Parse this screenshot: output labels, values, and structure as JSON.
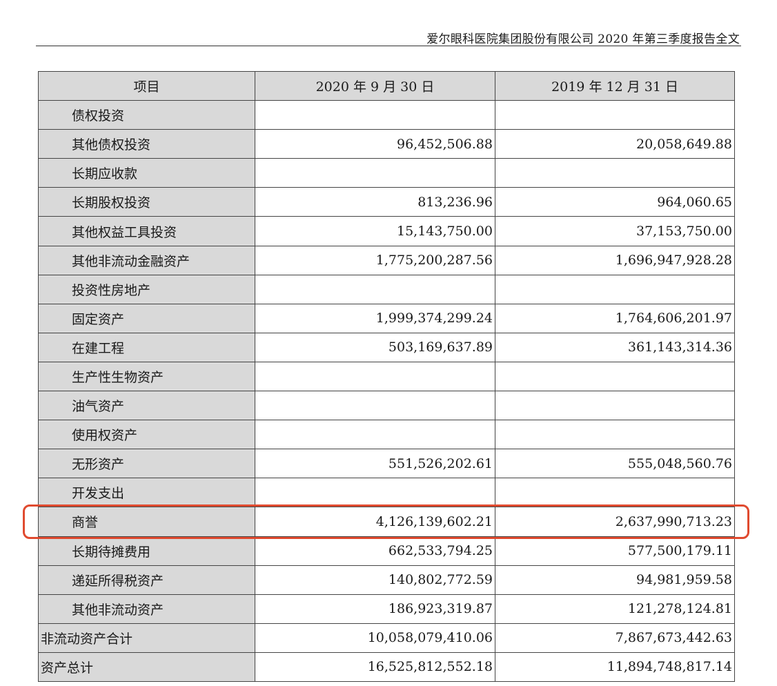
{
  "header": {
    "title": "爱尔眼科医院集团股份有限公司 2020 年第三季度报告全文"
  },
  "table": {
    "columns": [
      "项目",
      "2020 年 9 月 30 日",
      "2019 年 12 月 31 日"
    ],
    "rows": [
      {
        "item": "债权投资",
        "a": "",
        "b": ""
      },
      {
        "item": "其他债权投资",
        "a": "96,452,506.88",
        "b": "20,058,649.88"
      },
      {
        "item": "长期应收款",
        "a": "",
        "b": ""
      },
      {
        "item": "长期股权投资",
        "a": "813,236.96",
        "b": "964,060.65"
      },
      {
        "item": "其他权益工具投资",
        "a": "15,143,750.00",
        "b": "37,153,750.00"
      },
      {
        "item": "其他非流动金融资产",
        "a": "1,775,200,287.56",
        "b": "1,696,947,928.28"
      },
      {
        "item": "投资性房地产",
        "a": "",
        "b": ""
      },
      {
        "item": "固定资产",
        "a": "1,999,374,299.24",
        "b": "1,764,606,201.97"
      },
      {
        "item": "在建工程",
        "a": "503,169,637.89",
        "b": "361,143,314.36"
      },
      {
        "item": "生产性生物资产",
        "a": "",
        "b": ""
      },
      {
        "item": "油气资产",
        "a": "",
        "b": ""
      },
      {
        "item": "使用权资产",
        "a": "",
        "b": ""
      },
      {
        "item": "无形资产",
        "a": "551,526,202.61",
        "b": "555,048,560.76"
      },
      {
        "item": "开发支出",
        "a": "",
        "b": ""
      },
      {
        "item": "商誉",
        "a": "4,126,139,602.21",
        "b": "2,637,990,713.23"
      },
      {
        "item": "长期待摊费用",
        "a": "662,533,794.25",
        "b": "577,500,179.11"
      },
      {
        "item": "递延所得税资产",
        "a": "140,802,772.59",
        "b": "94,981,959.58"
      },
      {
        "item": "其他非流动资产",
        "a": "186,923,319.87",
        "b": "121,278,124.81"
      },
      {
        "item": "非流动资产合计",
        "a": "10,058,079,410.06",
        "b": "7,867,673,442.63"
      },
      {
        "item": "资产总计",
        "a": "16,525,812,552.18",
        "b": "11,894,748,817.14"
      }
    ]
  },
  "highlight": {
    "color": "#e04a2f"
  }
}
